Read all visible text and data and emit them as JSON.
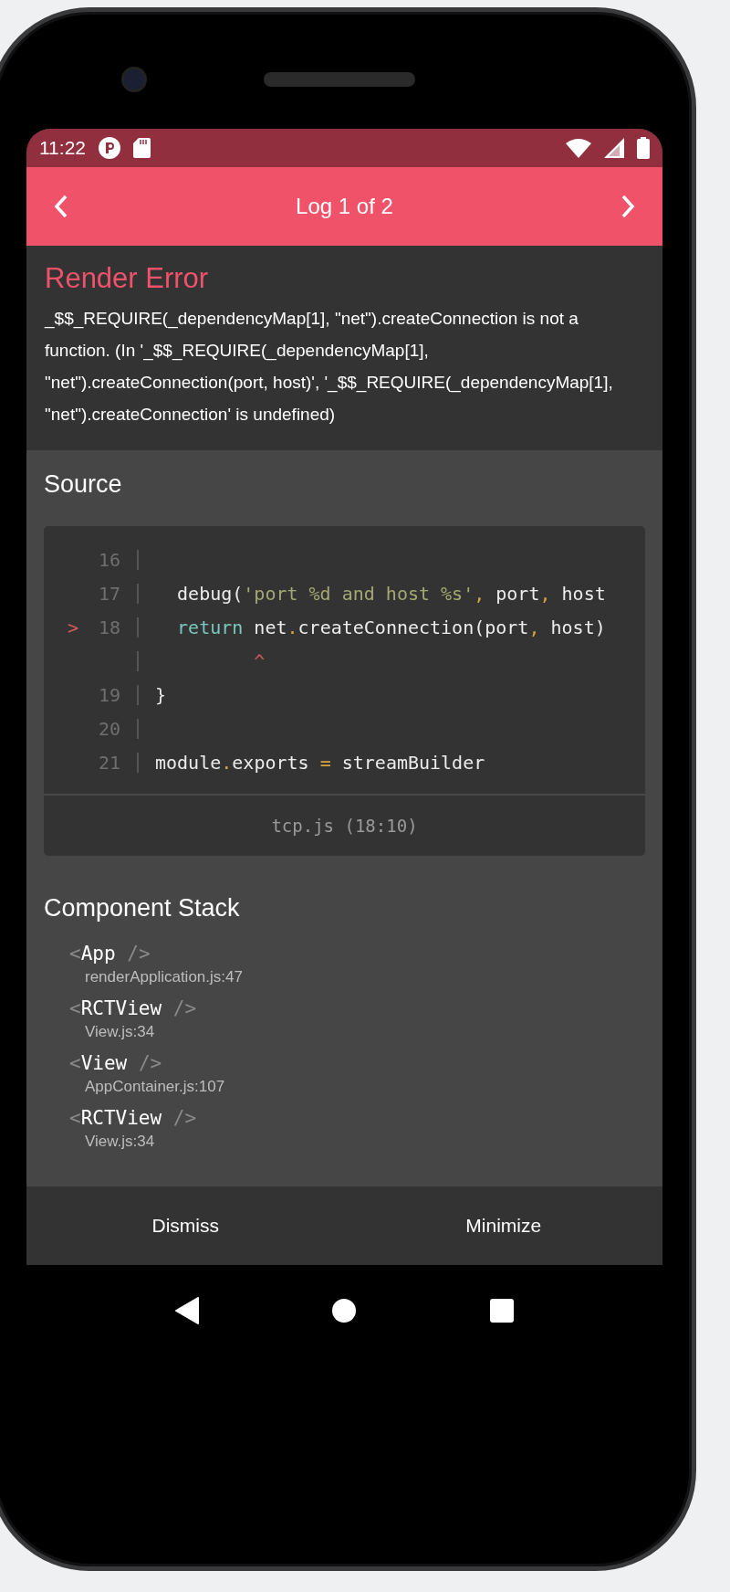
{
  "status_bar": {
    "time": "11:22"
  },
  "header": {
    "title": "Log 1 of 2"
  },
  "error": {
    "title": "Render Error",
    "message": "_$$_REQUIRE(_dependencyMap[1], \"net\").createConnection is not a function. (In '_$$_REQUIRE(_dependencyMap[1], \"net\").createConnection(port, host)', '_$$_REQUIRE(_dependencyMap[1], \"net\").createConnection' is undefined)"
  },
  "source": {
    "heading": "Source",
    "file": "tcp.js (18:10)",
    "lines": [
      {
        "number": "16"
      },
      {
        "number": "17",
        "tokens": [
          {
            "text": "  debug(",
            "kind": "plain"
          },
          {
            "text": "'port %d and host %s'",
            "kind": "string"
          },
          {
            "text": ",",
            "kind": "punct"
          },
          {
            "text": " port",
            "kind": "plain"
          },
          {
            "text": ",",
            "kind": "punct"
          },
          {
            "text": " host",
            "kind": "plain"
          }
        ]
      },
      {
        "number": "18",
        "marker": ">",
        "tokens": [
          {
            "text": "  return",
            "kind": "keyword"
          },
          {
            "text": " net",
            "kind": "plain"
          },
          {
            "text": ".",
            "kind": "punct"
          },
          {
            "text": "createConnection(port",
            "kind": "plain"
          },
          {
            "text": ",",
            "kind": "punct"
          },
          {
            "text": " host)",
            "kind": "plain"
          }
        ]
      },
      {
        "tokens": [
          {
            "text": "         ^",
            "kind": "error"
          }
        ]
      },
      {
        "number": "19",
        "tokens": [
          {
            "text": "}",
            "kind": "plain"
          }
        ]
      },
      {
        "number": "20"
      },
      {
        "number": "21",
        "tokens": [
          {
            "text": "module",
            "kind": "plain"
          },
          {
            "text": ".",
            "kind": "punct"
          },
          {
            "text": "exports ",
            "kind": "plain"
          },
          {
            "text": "=",
            "kind": "punct"
          },
          {
            "text": " streamBuilder",
            "kind": "plain"
          }
        ]
      }
    ]
  },
  "component_stack": {
    "heading": "Component Stack",
    "items": [
      {
        "open": "<",
        "name": "App",
        "close": "/>",
        "location": "renderApplication.js:47"
      },
      {
        "open": "<",
        "name": "RCTView",
        "close": "/>",
        "location": "View.js:34"
      },
      {
        "open": "<",
        "name": "View",
        "close": "/>",
        "location": "AppContainer.js:107"
      },
      {
        "open": "<",
        "name": "RCTView",
        "close": "/>",
        "location": "View.js:34"
      }
    ]
  },
  "buttons": [
    "Dismiss",
    "Minimize"
  ]
}
